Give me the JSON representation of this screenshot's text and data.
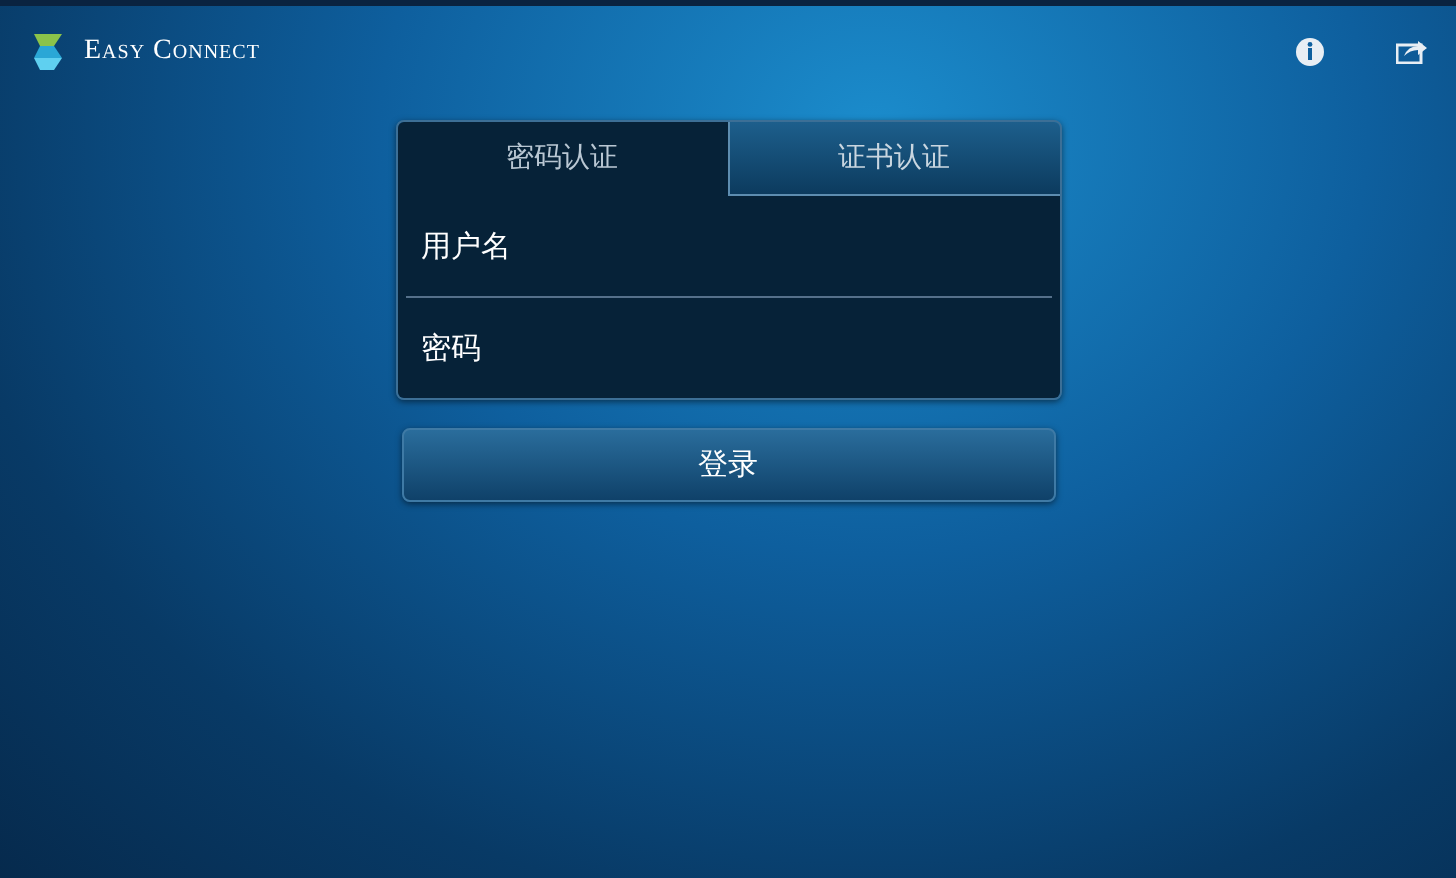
{
  "header": {
    "app_name": "Easy Connect"
  },
  "tabs": [
    {
      "label": "密码认证",
      "selected": true
    },
    {
      "label": "证书认证",
      "selected": false
    }
  ],
  "fields": [
    {
      "placeholder": "用户名"
    },
    {
      "placeholder": "密码"
    }
  ],
  "login_button": {
    "label": "登录"
  }
}
